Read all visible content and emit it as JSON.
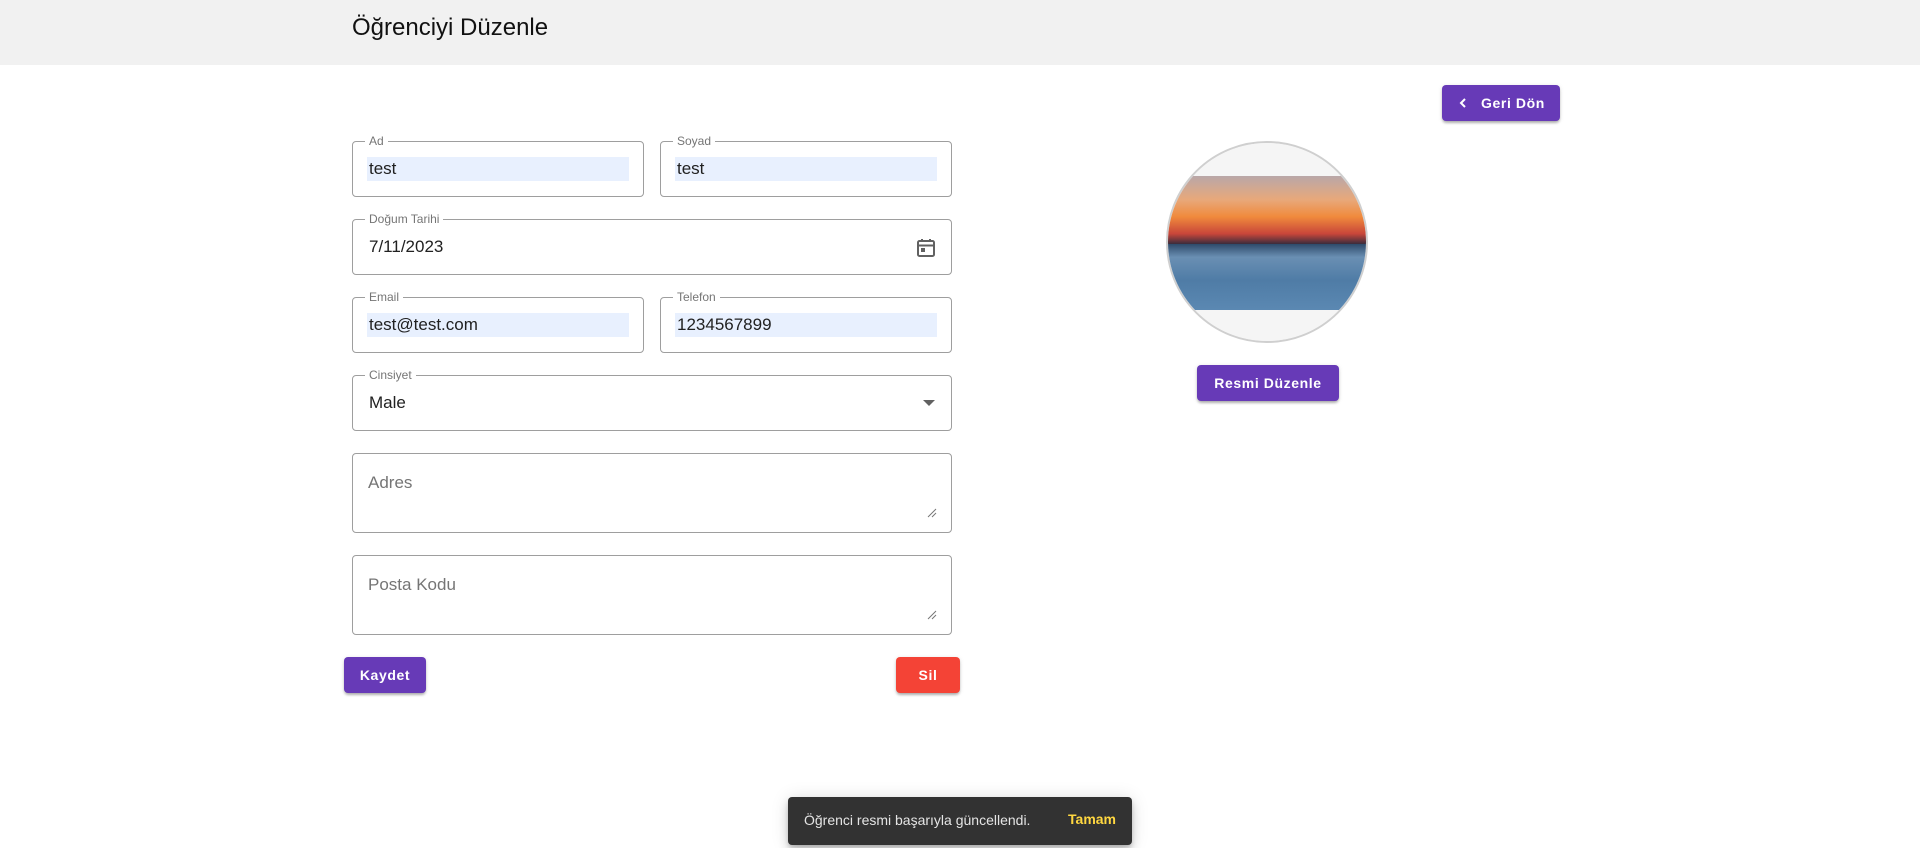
{
  "header": {
    "title": "Öğrenciyi Düzenle"
  },
  "back_button": {
    "label": "Geri Dön",
    "icon": "chevron-left-icon"
  },
  "form": {
    "first_name": {
      "label": "Ad",
      "value": "test"
    },
    "last_name": {
      "label": "Soyad",
      "value": "test"
    },
    "birth_date": {
      "label": "Doğum Tarihi",
      "value": "7/11/2023",
      "icon": "calendar-icon"
    },
    "email": {
      "label": "Email",
      "value": "test@test.com"
    },
    "phone": {
      "label": "Telefon",
      "value": "1234567899"
    },
    "gender": {
      "label": "Cinsiyet",
      "value": "Male",
      "icon": "caret-down-icon"
    },
    "address": {
      "placeholder": "Adres"
    },
    "postal_code": {
      "placeholder": "Posta Kodu"
    }
  },
  "actions": {
    "save_label": "Kaydet",
    "delete_label": "Sil"
  },
  "photo": {
    "edit_label": "Resmi Düzenle"
  },
  "snackbar": {
    "message": "Öğrenci resmi başarıyla güncellendi.",
    "action": "Tamam"
  },
  "colors": {
    "primary": "#673ab7",
    "danger": "#f44336",
    "autofill": "#e8f0fe",
    "snackbar_bg": "#323232",
    "snackbar_action": "#ffd740",
    "header_bg": "#f1f1f1"
  }
}
